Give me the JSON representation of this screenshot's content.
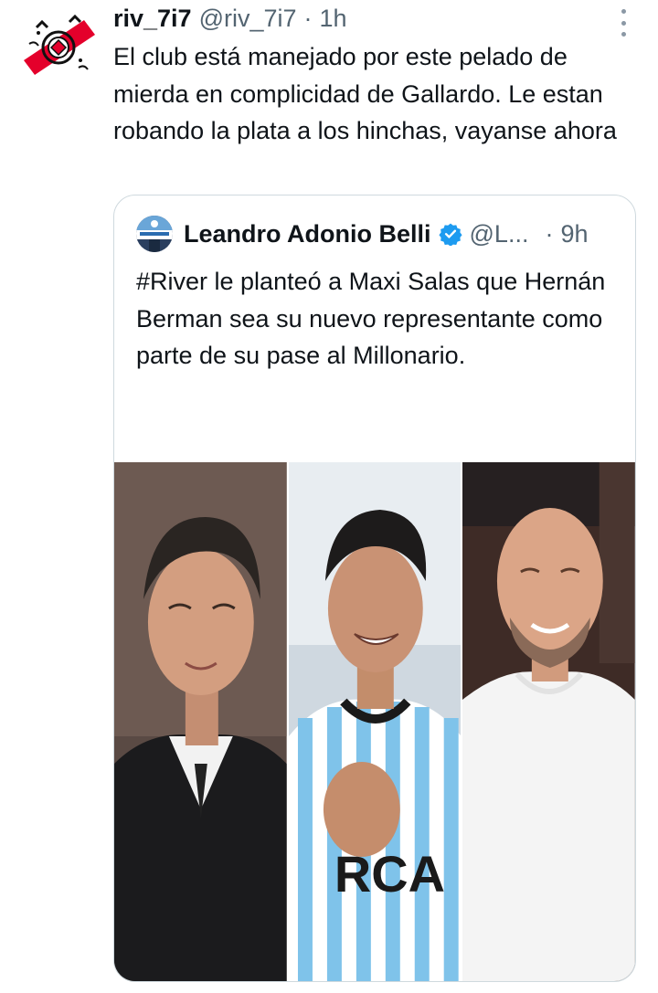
{
  "tweet": {
    "display_name": "riv_7i7",
    "handle": "@riv_7i7",
    "separator": "·",
    "time": "1h",
    "text": "El club está manejado por este pelado de mierda en complicidad de Gallardo. Le estan robando la plata a los hinchas, vayanse ahora",
    "avatar_icon": "river-plate-crest-icon",
    "more_icon": "more-options-icon"
  },
  "quoted": {
    "display_name": "Leandro Adonio Belli",
    "handle": "@L...",
    "separator": "·",
    "time": "9h",
    "verified_icon": "verified-badge-icon",
    "text": "#River le planteó a Maxi Salas que Hernán Berman sea su nuevo representante como parte de su pase al Millonario.",
    "truncation": "...",
    "media": [
      "photo-man-dark-suit",
      "photo-player-racing-jersey",
      "photo-bald-man-white-shirt"
    ]
  },
  "colors": {
    "text": "#0f1419",
    "secondary": "#536471",
    "border": "#cfd9de",
    "verified": "#1d9bf0",
    "river_red": "#e4002b"
  }
}
